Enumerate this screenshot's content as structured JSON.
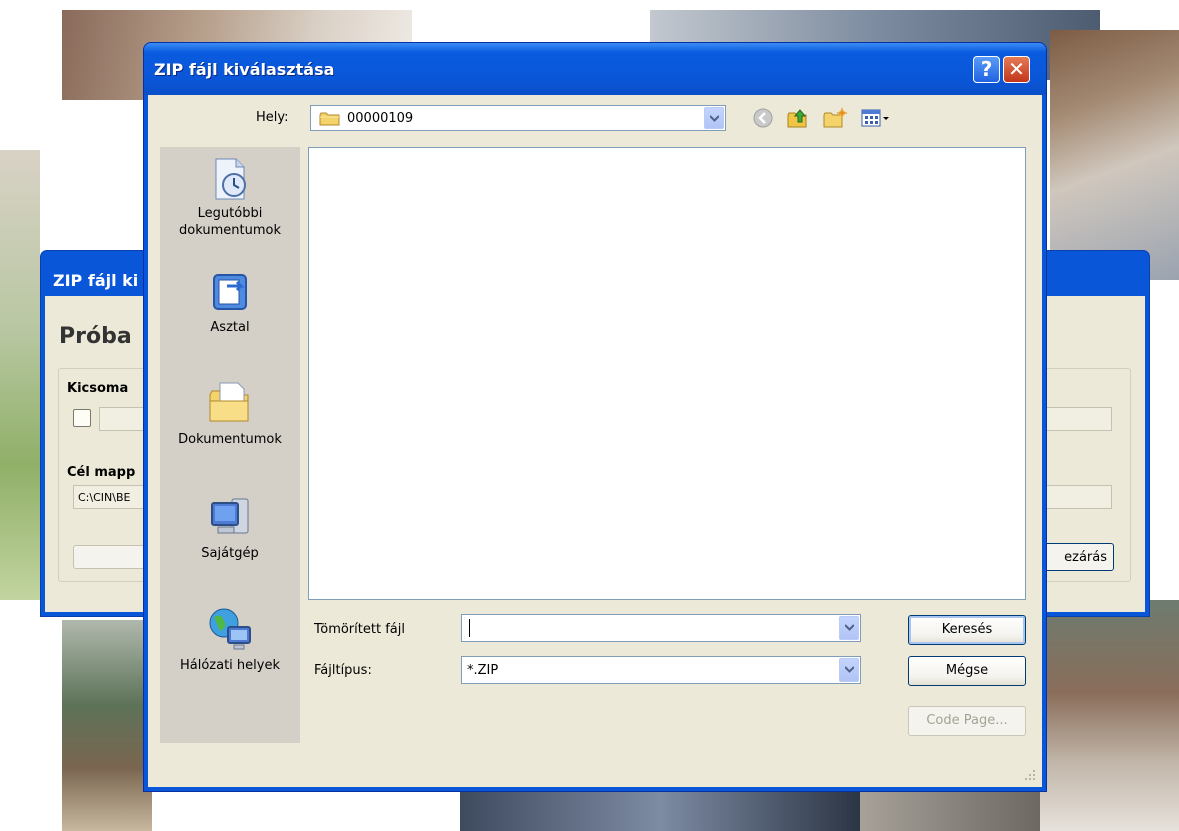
{
  "dialog": {
    "title": "ZIP fájl kiválasztása",
    "help_glyph": "?",
    "close_glyph": "✕",
    "look_in_label": "Hely:",
    "look_in_value": "00000109",
    "places": [
      {
        "label_line1": "Legutóbbi",
        "label_line2": "dokumentumok",
        "icon": "recent-documents-icon"
      },
      {
        "label_line1": "Asztal",
        "label_line2": "",
        "icon": "desktop-icon"
      },
      {
        "label_line1": "Dokumentumok",
        "label_line2": "",
        "icon": "my-documents-icon"
      },
      {
        "label_line1": "Sajátgép",
        "label_line2": "",
        "icon": "my-computer-icon"
      },
      {
        "label_line1": "Hálózati helyek",
        "label_line2": "",
        "icon": "network-places-icon"
      }
    ],
    "filename_label": "Tömörített fájl",
    "filename_value": "",
    "filetype_label": "Fájltípus:",
    "filetype_value": "*.ZIP",
    "buttons": {
      "search": "Keresés",
      "cancel": "Mégse",
      "code_page": "Code Page..."
    }
  },
  "back_window": {
    "title": "ZIP fájl ki",
    "heading": "Próba",
    "package_label": "Kicsoma",
    "target_label": "Cél mapp",
    "target_value": "C:\\CIN\\BE",
    "close_button": "ezárás"
  },
  "colors": {
    "title_bar": "#0a56d8",
    "dialog_face": "#ece9d8",
    "close_button": "#c2361a"
  }
}
